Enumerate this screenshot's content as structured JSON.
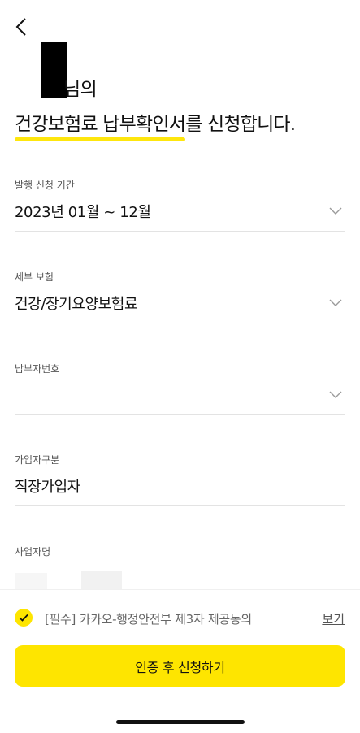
{
  "header": {
    "back_icon": "chevron-left-icon"
  },
  "title": {
    "name_suffix": "님의",
    "highlight": "건강보험료 납부확인서",
    "rest": "를 신청합니다."
  },
  "fields": [
    {
      "label": "발행 신청 기간",
      "value": "2023년 01월 ~ 12월",
      "dropdown": true
    },
    {
      "label": "세부 보험",
      "value": "건강/장기요양보험료",
      "dropdown": true
    },
    {
      "label": "납부자번호",
      "value": "",
      "dropdown": true
    },
    {
      "label": "가입자구분",
      "value": "직장가입자",
      "dropdown": false
    },
    {
      "label": "사업자명",
      "value": "",
      "dropdown": false
    }
  ],
  "consent": {
    "text": "[필수] 카카오-행정안전부 제3자 제공동의",
    "view_label": "보기",
    "checked": true
  },
  "cta": {
    "label": "인증 후 신청하기"
  },
  "colors": {
    "accent": "#fee500",
    "text": "#111111",
    "label": "#555555",
    "divider": "#e3e3e3"
  }
}
